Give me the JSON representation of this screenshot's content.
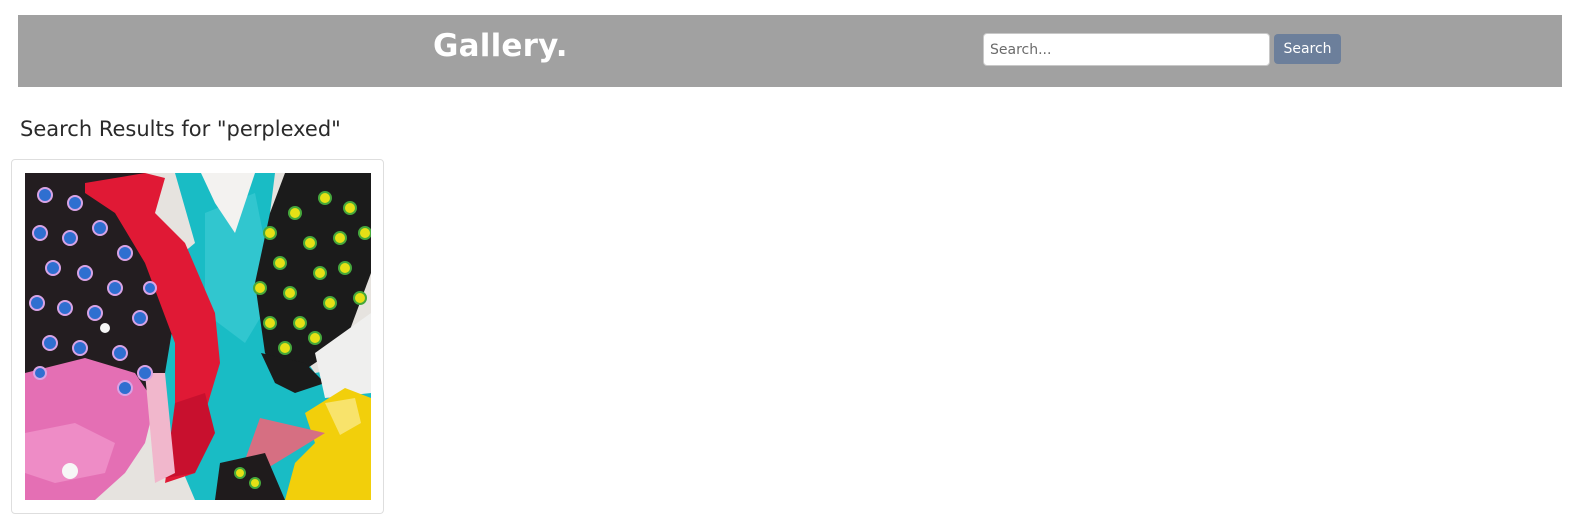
{
  "header": {
    "brand": "Gallery.",
    "search": {
      "placeholder": "Search...",
      "value": "",
      "button_label": "Search"
    },
    "background_color": "#a1a1a1",
    "button_color": "#6c7f9b"
  },
  "main": {
    "results_title": "Search Results for \"perplexed\"",
    "results": [
      {
        "type": "artwork-thumbnail",
        "description_icon": "abstract-painting-image"
      }
    ]
  }
}
